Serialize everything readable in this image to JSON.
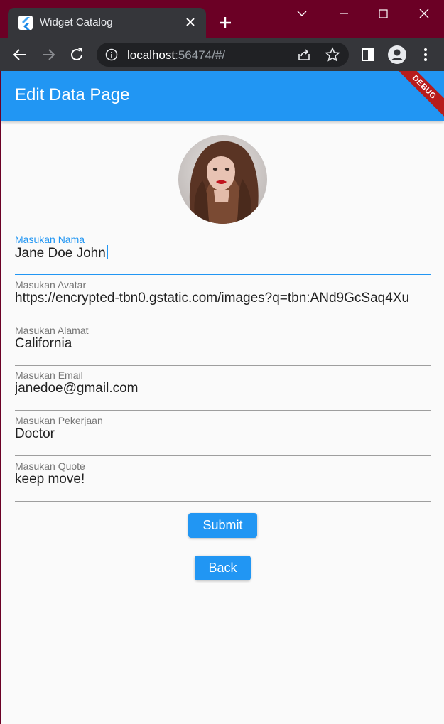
{
  "browser": {
    "tab_title": "Widget Catalog",
    "url_host": "localhost",
    "url_rest": ":56474/#/"
  },
  "app": {
    "title": "Edit Data Page",
    "debug_banner": "DEBUG",
    "accent_color": "#2196f3"
  },
  "form": {
    "fields": [
      {
        "label": "Masukan Nama",
        "value": "Jane Doe John"
      },
      {
        "label": "Masukan Avatar",
        "value": "https://encrypted-tbn0.gstatic.com/images?q=tbn:ANd9GcSaq4Xu"
      },
      {
        "label": "Masukan Alamat",
        "value": "California"
      },
      {
        "label": "Masukan Email",
        "value": "janedoe@gmail.com"
      },
      {
        "label": "Masukan Pekerjaan",
        "value": "Doctor"
      },
      {
        "label": "Masukan Quote",
        "value": "keep move!"
      }
    ],
    "submit_label": "Submit",
    "back_label": "Back"
  },
  "icons": {
    "favicon": "flutter-icon",
    "tab_close": "close-icon",
    "new_tab": "plus-icon",
    "back": "arrow-left-icon",
    "forward": "arrow-right-icon",
    "reload": "reload-icon",
    "site_info": "info-icon",
    "share": "share-icon",
    "bookmark": "star-icon",
    "side_panel": "side-panel-icon",
    "profile": "profile-icon",
    "menu": "kebab-menu-icon"
  }
}
